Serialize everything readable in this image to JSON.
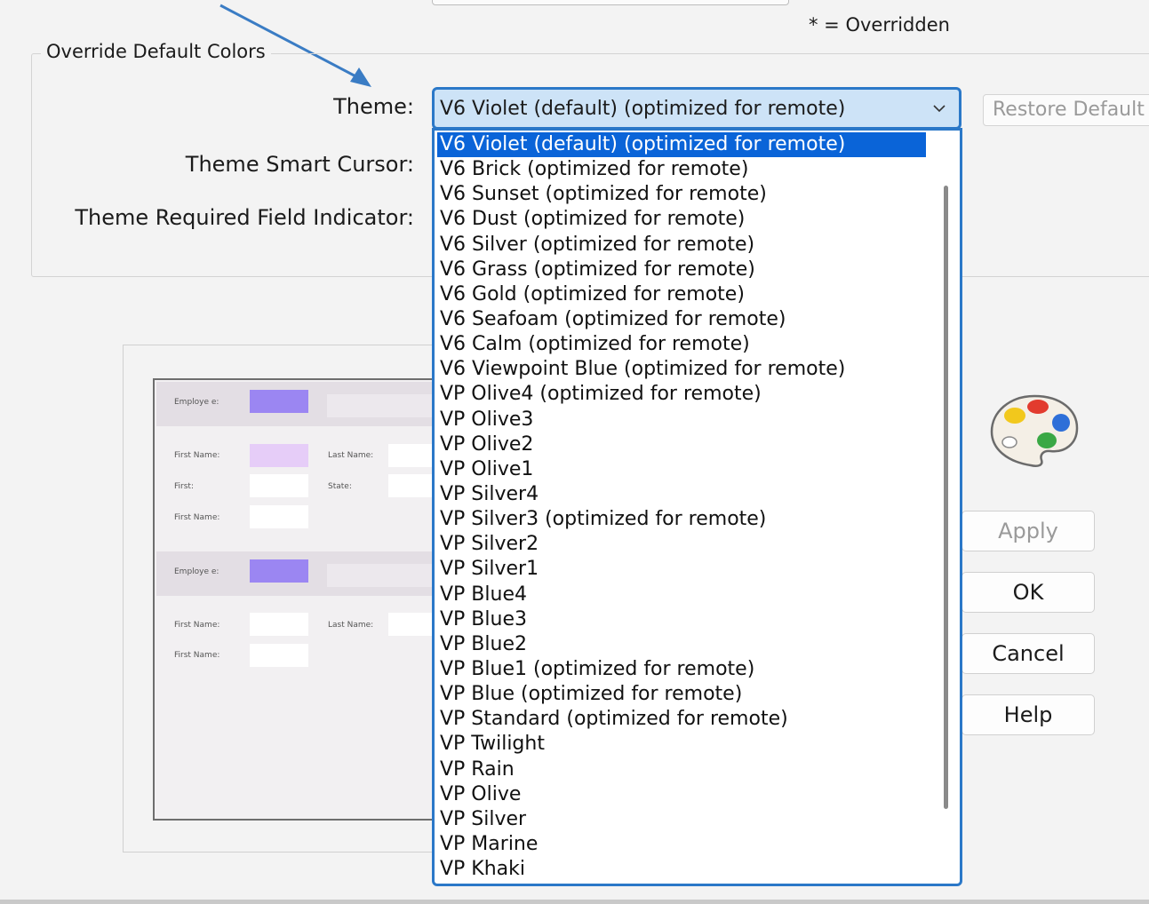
{
  "header": {
    "overridden_note": "* = Overridden"
  },
  "group": {
    "legend": "Override Default Colors",
    "theme_label": "Theme:",
    "cursor_label": "Theme Smart Cursor:",
    "required_label": "Theme Required Field Indicator:"
  },
  "combo": {
    "value": "V6 Violet (default) (optimized for remote)"
  },
  "restore_button": {
    "label": "Restore Default"
  },
  "dropdown": {
    "selected_index": 0,
    "items": [
      "V6 Violet (default) (optimized for remote)",
      "V6 Brick (optimized for remote)",
      "V6 Sunset (optimized for remote)",
      "V6 Dust (optimized for remote)",
      "V6 Silver (optimized for remote)",
      "V6 Grass (optimized for remote)",
      "V6 Gold (optimized for remote)",
      "V6 Seafoam (optimized for remote)",
      "V6 Calm (optimized for remote)",
      "V6 Viewpoint Blue (optimized for remote)",
      "VP Olive4 (optimized for remote)",
      "VP Olive3",
      "VP Olive2",
      "VP Olive1",
      "VP Silver4",
      "VP Silver3 (optimized for remote)",
      "VP Silver2",
      "VP Silver1",
      "VP Blue4",
      "VP Blue3",
      "VP Blue2",
      "VP Blue1 (optimized for remote)",
      "VP Blue (optimized for remote)",
      "VP Standard (optimized for remote)",
      "VP Twilight",
      "VP Rain",
      "VP Olive",
      "VP Silver",
      "VP Marine",
      "VP Khaki"
    ]
  },
  "preview": {
    "employee_label": "Employe e:",
    "first_name": "First Name:",
    "last_name": "Last Name:",
    "first": "First:",
    "state": "State:",
    "swatch_primary": "#9b86f2",
    "swatch_light": "#e6cdf8"
  },
  "buttons": {
    "apply": "Apply",
    "ok": "OK",
    "cancel": "Cancel",
    "help": "Help"
  },
  "colors": {
    "accent": "#2b78c8",
    "selection": "#0a64d8",
    "combo_bg": "#cde3f7"
  }
}
